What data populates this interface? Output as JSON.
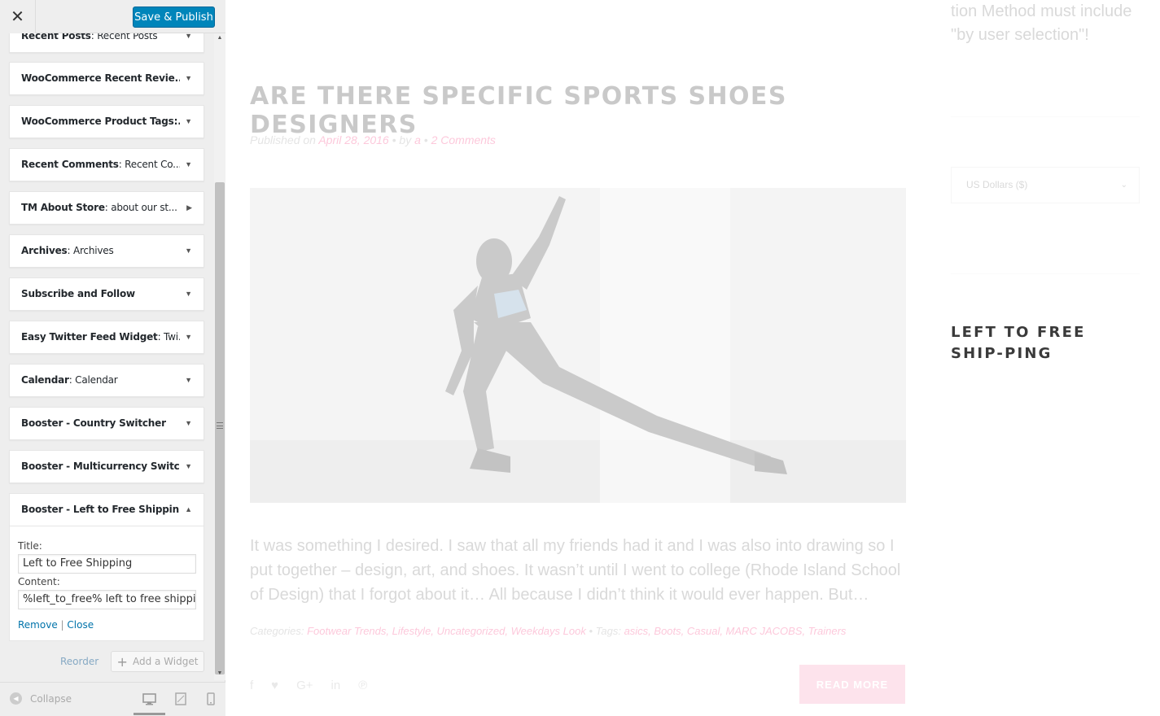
{
  "header": {
    "close_icon": "close-icon",
    "save_label": "Save & Publish",
    "save_color": "#0085ba"
  },
  "widgets": [
    {
      "title": "Recent Posts",
      "subtitle": ": Recent Posts",
      "state": "collapsed"
    },
    {
      "title": "WooCommerce Recent Revie...",
      "subtitle": "",
      "state": "collapsed"
    },
    {
      "title": "WooCommerce Product Tags:...",
      "subtitle": "",
      "state": "collapsed"
    },
    {
      "title": "Recent Comments",
      "subtitle": ": Recent Co...",
      "state": "collapsed"
    },
    {
      "title": "TM About Store",
      "subtitle": ": about our st...",
      "state": "pointing-right"
    },
    {
      "title": "Archives",
      "subtitle": ": Archives",
      "state": "collapsed"
    },
    {
      "title": "Subscribe and Follow",
      "subtitle": "",
      "state": "collapsed"
    },
    {
      "title": "Easy Twitter Feed Widget",
      "subtitle": ": Twi...",
      "state": "collapsed"
    },
    {
      "title": "Calendar",
      "subtitle": ": Calendar",
      "state": "collapsed"
    },
    {
      "title": "Booster - Country Switcher",
      "subtitle": "",
      "state": "collapsed"
    },
    {
      "title": "Booster - Multicurrency Switc...",
      "subtitle": "",
      "state": "collapsed"
    }
  ],
  "open_widget": {
    "title": "Booster - Left to Free Shippin...",
    "form": {
      "title_label": "Title:",
      "title_value": "Left to Free Shipping",
      "content_label": "Content:",
      "content_value": "%left_to_free% left to free shipping"
    },
    "remove_label": "Remove",
    "separator": "|",
    "close_label": "Close"
  },
  "actions": {
    "reorder_label": "Reorder",
    "add_widget_label": "Add a Widget"
  },
  "footer": {
    "collapse_label": "Collapse",
    "devices": [
      "desktop-icon",
      "tablet-icon",
      "mobile-icon"
    ],
    "active_device": "desktop"
  },
  "preview": {
    "top_sidebar_text": "tion Method must include \"by user selection\"!",
    "post": {
      "title": "ARE THERE SPECIFIC SPORTS SHOES DESIGNERS",
      "meta_published": "Published on ",
      "meta_date": "April 28, 2016",
      "meta_bullet1": " • by ",
      "meta_author": "a",
      "meta_bullet2": " • ",
      "meta_comments": "2 Comments",
      "excerpt": "It was something I desired. I saw that all my friends had it and I was also into drawing so I put together – design, art, and shoes. It wasn’t until I went to college (Rhode Island School of Design) that I forgot about it… All because I didn’t think it would ever happen. But…",
      "categories_label": "Categories: ",
      "categories": "Footwear Trends, Lifestyle, Uncategorized, Weekdays Look",
      "tags_label": " • Tags: ",
      "tags": "asics, Boots, Casual, MARC JACOBS, Trainers",
      "read_more": "READ MORE",
      "social_icons": [
        "f",
        "♥",
        "G+",
        "in",
        "℗"
      ]
    },
    "currency_selected": "US Dollars ($)",
    "free_shipping_title": "LEFT TO FREE SHIP-PING",
    "accent_color": "#f7538d"
  }
}
